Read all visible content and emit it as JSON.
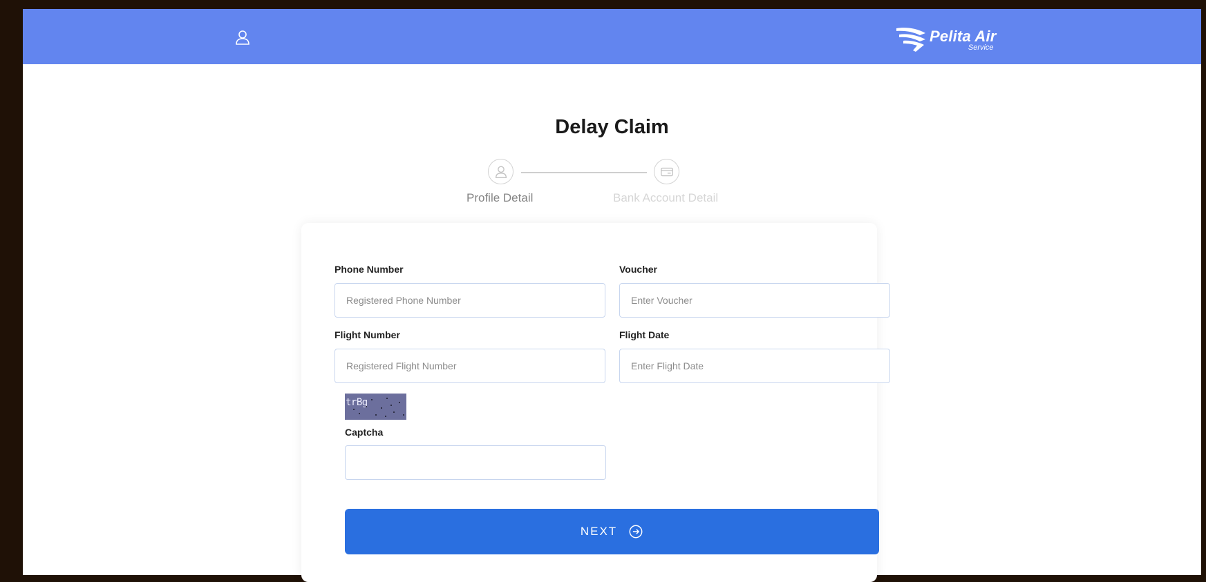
{
  "header": {
    "brand_name": "Pelita Air",
    "brand_sub": "Service",
    "brand_color": "#6285ef",
    "user_icon": "user-icon"
  },
  "page": {
    "title": "Delay Claim"
  },
  "stepper": {
    "steps": [
      {
        "label": "Profile Detail",
        "icon": "user-icon",
        "active": true
      },
      {
        "label": "Bank Account Detail",
        "icon": "credit-card-icon",
        "active": false
      }
    ]
  },
  "form": {
    "phone": {
      "label": "Phone Number",
      "placeholder": "Registered Phone Number",
      "value": ""
    },
    "voucher": {
      "label": "Voucher",
      "placeholder": "Enter Voucher",
      "value": ""
    },
    "flight_number": {
      "label": "Flight Number",
      "placeholder": "Registered Flight Number",
      "value": ""
    },
    "flight_date": {
      "label": "Flight Date",
      "placeholder": "Enter Flight Date",
      "value": ""
    },
    "captcha": {
      "image_text": "trBg",
      "label": "Captcha",
      "value": ""
    },
    "next_button": {
      "label": "NEXT",
      "icon": "arrow-right-circle-icon",
      "color": "#2a6fe0"
    }
  }
}
